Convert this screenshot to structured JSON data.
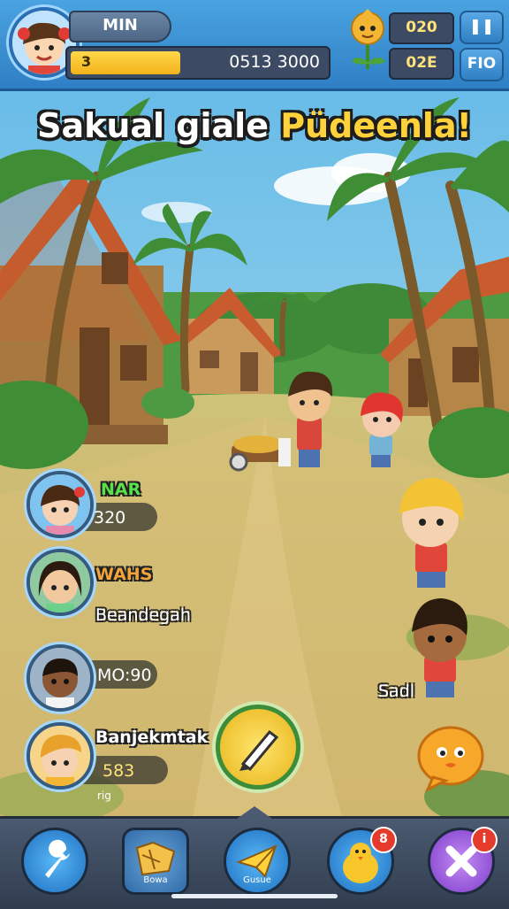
{
  "hud": {
    "player_name": "MIN",
    "level": "3",
    "score_text": "0513 3000",
    "resource_top": "020",
    "resource_bottom": "02E",
    "pause_label": "❚❚",
    "fio_label": "FIO",
    "level_progress": 0.43
  },
  "title": {
    "part1": "Sakual giale ",
    "part2": "Püdeenla!"
  },
  "players": [
    {
      "name": "NAR",
      "value": "320",
      "name_color": "#59e04a"
    },
    {
      "name": "WAHS",
      "value": "Beandegah",
      "name_color": "#f2a43a"
    },
    {
      "name": "",
      "value": "MO:90",
      "name_color": "#ffffff"
    },
    {
      "name": "Banjekmtak",
      "value": "583",
      "sub": "rig",
      "name_color": "#ffffff"
    }
  ],
  "npc_label": "Sadl",
  "nav": [
    {
      "label": "",
      "icon": "wrench-icon",
      "badge": ""
    },
    {
      "label": "Bowa",
      "icon": "map-icon",
      "badge": ""
    },
    {
      "label": "Gusue",
      "icon": "paper-plane-icon",
      "badge": ""
    },
    {
      "label": "",
      "icon": "chick-icon",
      "badge": "8"
    },
    {
      "label": "",
      "icon": "close-icon",
      "badge": "i"
    }
  ],
  "colors": {
    "sky": "#7ec8ea",
    "hud_blue": "#2f7fc4",
    "gold": "#ffd23c",
    "nav_bg": "#3c4a5e"
  }
}
